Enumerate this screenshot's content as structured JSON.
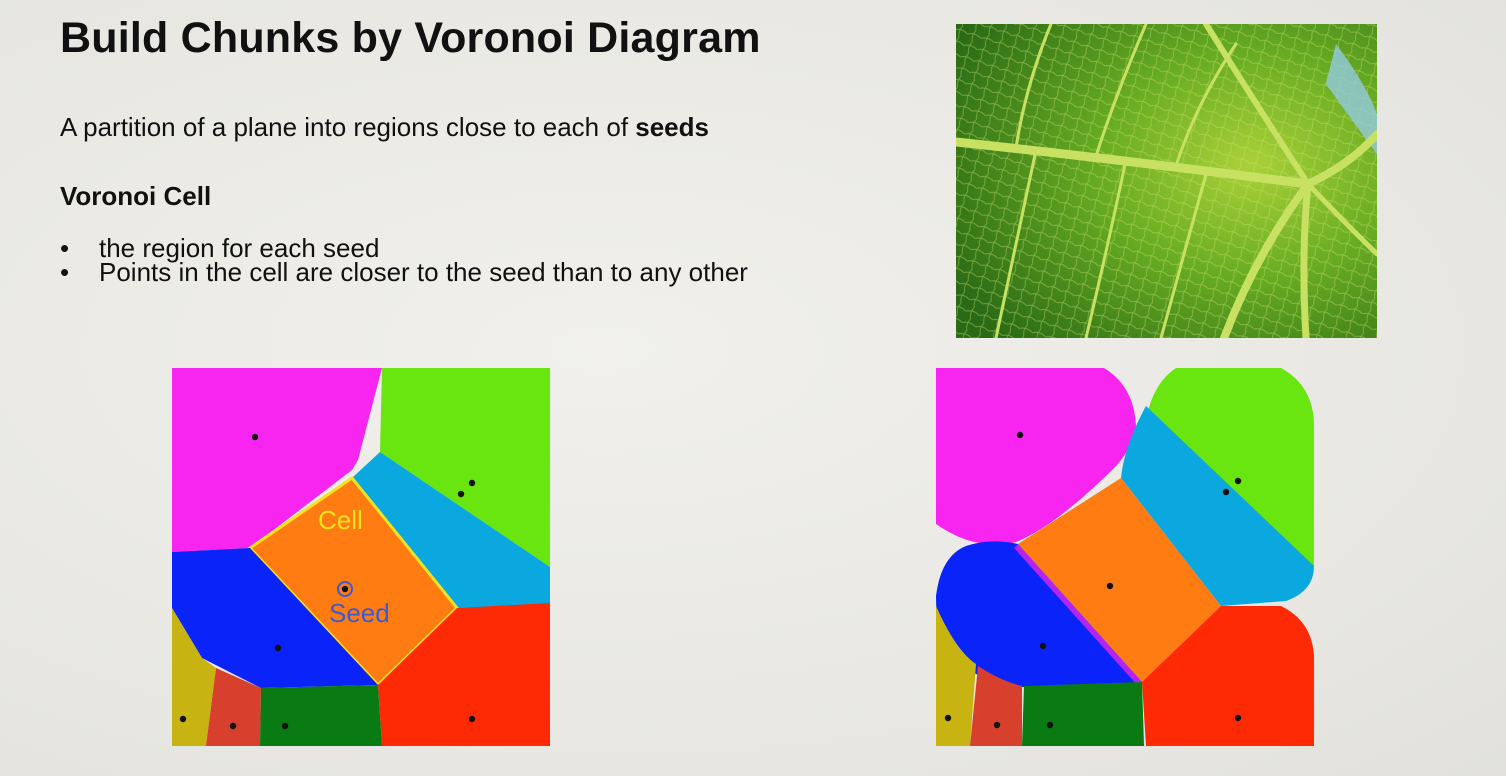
{
  "slide": {
    "title": "Build Chunks by Voronoi Diagram",
    "subtitle_prefix": "A partition of a plane into regions close to each of ",
    "subtitle_bold": "seeds",
    "heading": "Voronoi Cell",
    "bullets": [
      "the region for each seed",
      "Points in the cell are closer to the seed than to any other"
    ],
    "bullet_glyph": "•"
  },
  "diagram_left": {
    "cell_label": "Cell",
    "seed_label": "Seed"
  },
  "colors": {
    "magenta": "#f825f0",
    "green": "#69e510",
    "cyan": "#0aa8df",
    "orange": "#fe7c12",
    "blue": "#0a23f8",
    "red": "#fe2a06",
    "olive": "#c7b413",
    "brick": "#d8402e",
    "darkgreen": "#0a7b12",
    "label_yellow": "#f5e21e",
    "seed_label": "#3e5ad0"
  }
}
